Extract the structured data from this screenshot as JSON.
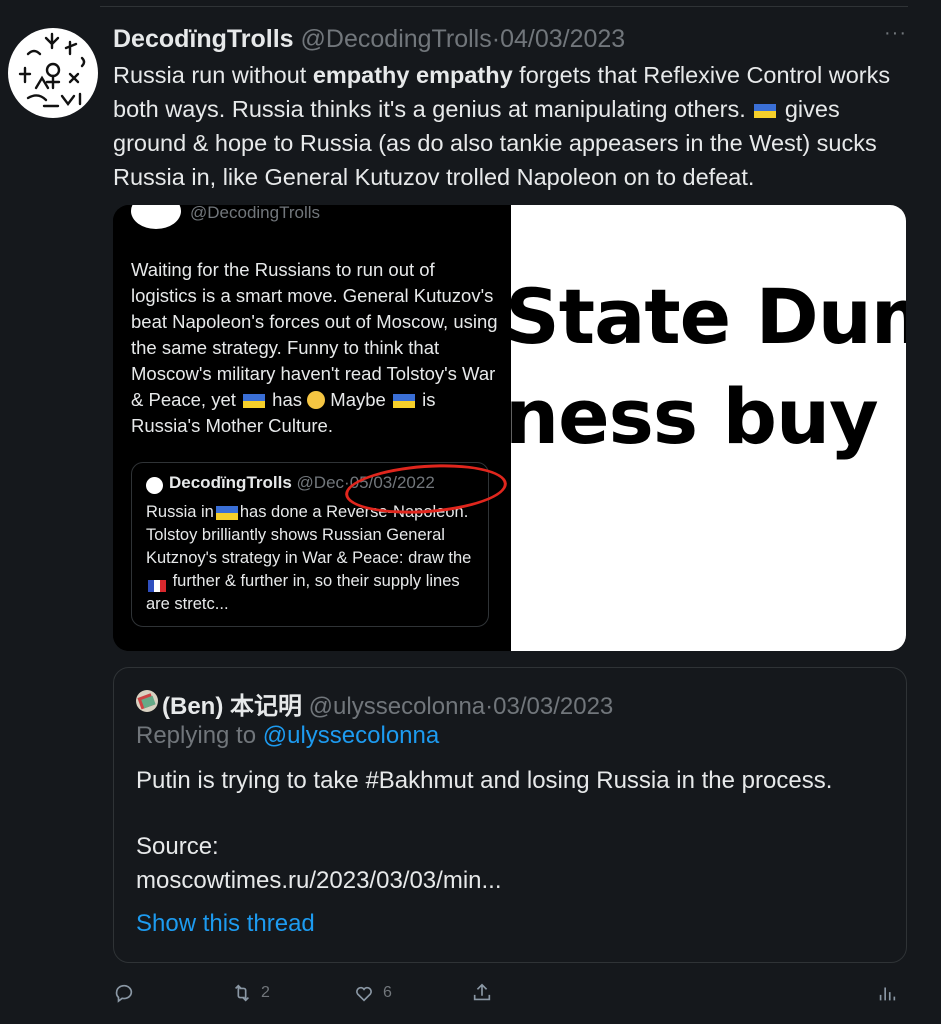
{
  "tweet": {
    "display_name": "DecodïngTrolls",
    "handle": "@DecodingTrolls",
    "separator": "·",
    "date": "04/03/2023",
    "more": "···",
    "text_part1": "Russia run without ",
    "text_bold": "empathy empathy",
    "text_part2": " forgets that Reflexive Control works both ways. Russia thinks it's a genius at manipulating others. ",
    "text_part3": " gives ground & hope to Russia (as do also tankie appeasers in the West) sucks Russia in, like General Kutuzov trolled Napoleon on to defeat."
  },
  "media": {
    "screenshot_handle": "@DecodingTrolls",
    "screenshot_text_1": "Waiting for the Russians to run out of logistics is a smart move. General Kutuzov's beat Napoleon's forces out of Moscow, using the same strategy. Funny to think that Moscow's military haven't read Tolstoy's War & Peace, yet ",
    "screenshot_text_2": " has ",
    "screenshot_text_3": " Maybe ",
    "screenshot_text_4": " is Russia's Mother Culture.",
    "inner_name": "DecodïngTrolls",
    "inner_handle": "@Dec",
    "inner_date": "05/03/2022",
    "inner_text_1": "Russia in",
    "inner_text_2": "has done a Reverse-Napoleon. Tolstoy brilliantly shows Russian General Kutznoy's strategy in War & Peace: draw the ",
    "inner_text_3": " further & further in, so their supply lines are stretc...",
    "headline_line1": "State Duma",
    "headline_line2": "ness buy ai"
  },
  "quote": {
    "name": "(Ben) 本记明",
    "handle": "@ulyssecolonna",
    "date": "03/03/2023",
    "replying_label": "Replying to ",
    "replying_mention": "@ulyssecolonna",
    "text": "Putin is trying to take #Bakhmut and losing Russia in the process.",
    "source_label": "Source:",
    "link": "moscowtimes.ru/2023/03/03/min...",
    "show_thread": "Show this thread"
  },
  "actions": {
    "reply_count": "",
    "retweet_count": "2",
    "like_count": "6"
  },
  "colors": {
    "background": "#15181c",
    "accent": "#1d9bf0",
    "muted": "#71767b",
    "annotation_red": "#e0261d"
  }
}
